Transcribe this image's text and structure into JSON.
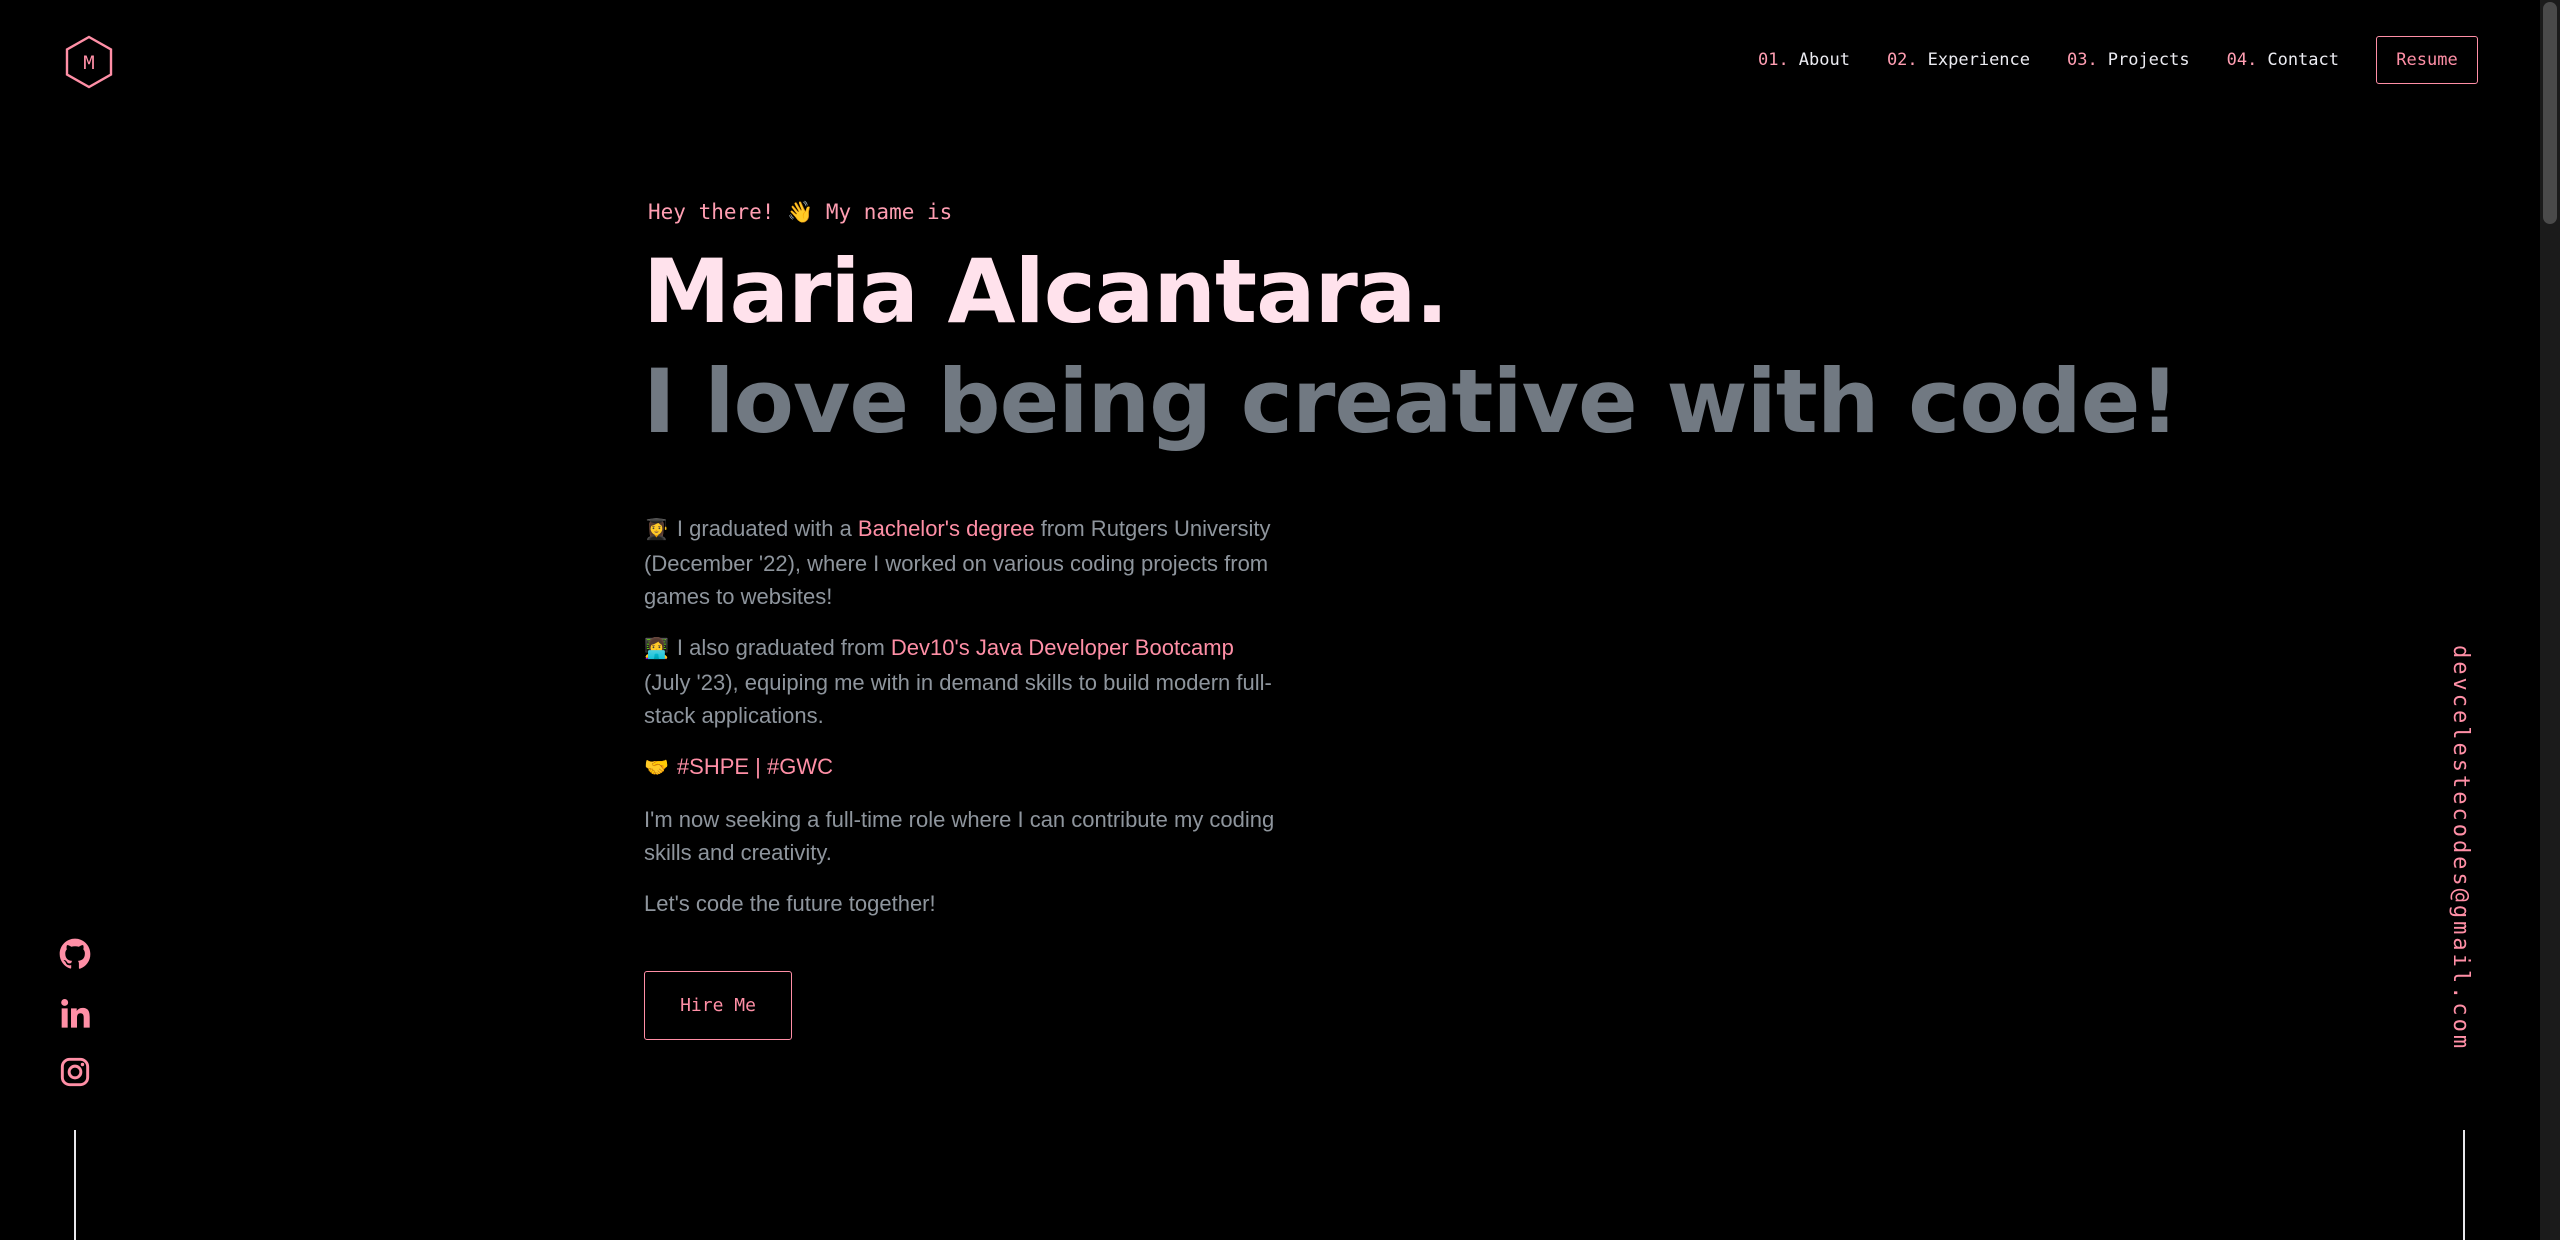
{
  "logo": {
    "letter": "M"
  },
  "nav": {
    "items": [
      {
        "num": "01.",
        "label": "About"
      },
      {
        "num": "02.",
        "label": "Experience"
      },
      {
        "num": "03.",
        "label": "Projects"
      },
      {
        "num": "04.",
        "label": "Contact"
      }
    ],
    "resume_label": "Resume"
  },
  "hero": {
    "greeting": "Hey there! 👋 My name is",
    "name": "Maria Alcantara.",
    "tagline": "I love being creative with code!"
  },
  "bio": {
    "p1": {
      "emoji": "👩‍🎓",
      "before": "I graduated with a ",
      "highlight": "Bachelor's degree",
      "after": " from Rutgers University (December '22), where I worked on various coding projects from games to websites!"
    },
    "p2": {
      "emoji": "👩‍💻",
      "before": "I also graduated from ",
      "highlight": "Dev10's Java Developer Bootcamp",
      "after": " (July '23), equiping me with in demand skills to build modern full-stack applications."
    },
    "p3": {
      "emoji": "🤝",
      "tag1": "#SHPE",
      "sep": " | ",
      "tag2": "#GWC"
    },
    "p4": "I'm now seeking a full-time role where I can contribute my coding skills and creativity.",
    "p5": "Let's code the future together!"
  },
  "hire_label": "Hire Me",
  "social": [
    "github-icon",
    "linkedin-icon",
    "instagram-icon"
  ],
  "email": "devcelestecodes@gmail.com",
  "colors": {
    "accent": "#ff8fa6",
    "name": "#ffe2ec",
    "tagline": "#717982",
    "body": "#8e959d",
    "background": "#000000"
  }
}
